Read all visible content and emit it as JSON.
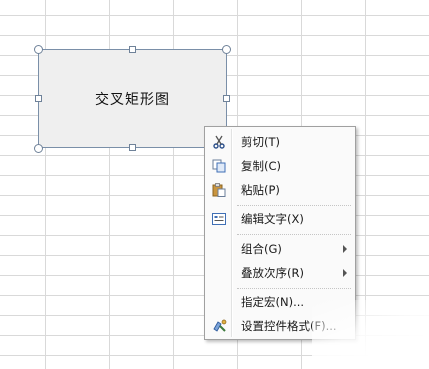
{
  "shape": {
    "label": "交叉矩形图"
  },
  "context_menu": {
    "items": [
      {
        "label": "剪切(T)",
        "icon": "scissors-icon"
      },
      {
        "label": "复制(C)",
        "icon": "copy-icon"
      },
      {
        "label": "粘贴(P)",
        "icon": "paste-icon"
      },
      {
        "label": "编辑文字(X)",
        "icon": "edit-text-icon"
      },
      {
        "label": "组合(G)",
        "submenu": true
      },
      {
        "label": "叠放次序(R)",
        "submenu": true
      },
      {
        "label": "指定宏(N)..."
      },
      {
        "label": "设置控件格式(F)...",
        "icon": "format-control-icon"
      }
    ]
  },
  "colors": {
    "shape_fill": "#efefef",
    "shape_border": "#7a8fa8",
    "menu_bg": "#fafafa",
    "grid_line": "#d9d9d9"
  }
}
